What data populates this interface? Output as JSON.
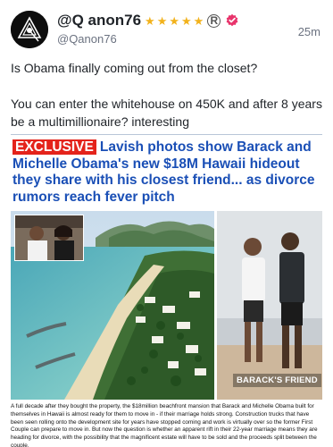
{
  "post": {
    "display_name": "@Q anon76",
    "star_glyphs": [
      "★",
      "★",
      "★",
      "★",
      "★"
    ],
    "registered_mark": "R",
    "handle": "@Qanon76",
    "time_ago": "25m",
    "paragraphs": [
      "Is Obama finally coming out from the closet?",
      "You can enter the whitehouse on 450K and after 8 years be a multimillionaire? interesting"
    ]
  },
  "article": {
    "badge": "EXCLUSIVE",
    "headline": "Lavish photos show Barack and Michelle Obama's new $18M Hawaii hideout they share with his closest friend... as divorce rumors reach fever pitch",
    "photo_tag": "BARACK'S FRIEND",
    "body": "A full decade after they bought the property, the $18million beachfront mansion that Barack and Michelle Obama built for themselves in Hawaii is almost ready for them to move in - if their marriage holds strong. Construction trucks that have been seen rolling onto the development site for years have stopped coming and work is virtually over so the former First Couple can prepare to move in. But now the question is whether an apparent rift in their 22-year marriage means they are heading for divorce, with the possibility that the magnificent estate will have to be sold and the proceeds split between the couple."
  },
  "colors": {
    "headline_blue": "#1a4fb6",
    "badge_red": "#e4231b",
    "star_gold": "#f2b21c",
    "verified_pink": "#e8336b"
  },
  "icons": {
    "avatar": "q-triangle-logo",
    "verified": "verified-badge-icon"
  }
}
